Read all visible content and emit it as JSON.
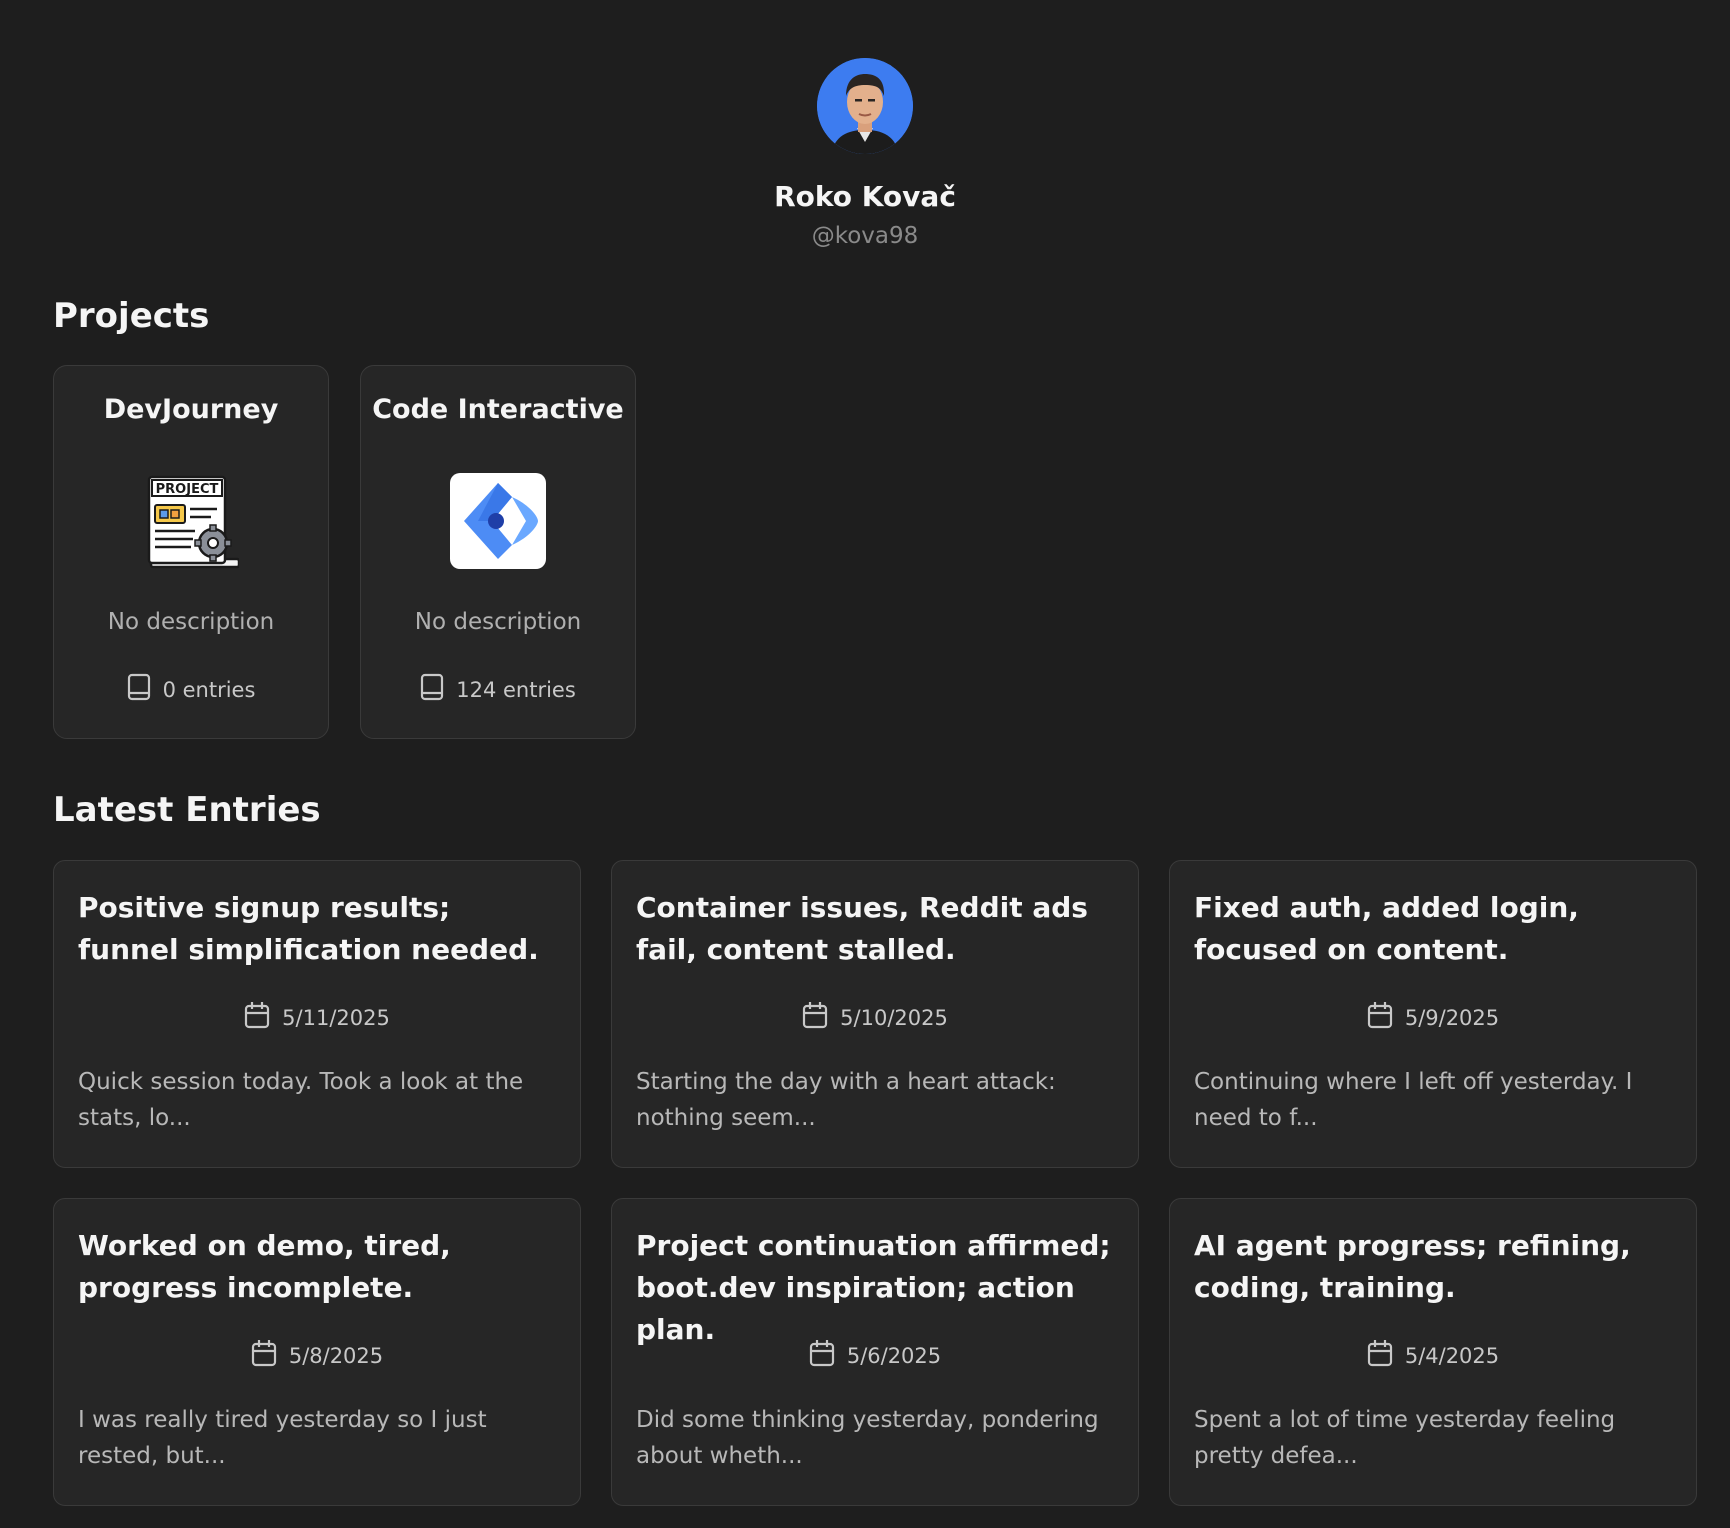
{
  "profile": {
    "name": "Roko Kovač",
    "handle": "@kova98"
  },
  "projects_section": {
    "title": "Projects"
  },
  "projects": [
    {
      "title": "DevJourney",
      "description": "No description",
      "entries": "0 entries"
    },
    {
      "title": "Code Interactive",
      "description": "No description",
      "entries": "124 entries"
    }
  ],
  "entries_section": {
    "title": "Latest Entries"
  },
  "entries": [
    {
      "title": "Positive signup results; funnel simplification needed.",
      "date": "5/11/2025",
      "excerpt": "Quick session today. Took a look at the stats, lo..."
    },
    {
      "title": "Container issues, Reddit ads fail, content stalled.",
      "date": "5/10/2025",
      "excerpt": "Starting the day with a heart attack: nothing seem..."
    },
    {
      "title": "Fixed auth, added login, focused on content.",
      "date": "5/9/2025",
      "excerpt": "Continuing where I left off yesterday. I need to f..."
    },
    {
      "title": "Worked on demo, tired, progress incomplete.",
      "date": "5/8/2025",
      "excerpt": "I was really tired yesterday so I just rested, but..."
    },
    {
      "title": "Project continuation affirmed; boot.dev inspiration; action plan.",
      "date": "5/6/2025",
      "excerpt": "Did some thinking yesterday, pondering about wheth..."
    },
    {
      "title": "AI agent progress; refining, coding, training.",
      "date": "5/4/2025",
      "excerpt": "Spent a lot of time yesterday feeling pretty defea..."
    }
  ],
  "colors": {
    "background": "#1e1e1e",
    "card": "#262626",
    "card_border": "#3a3a3a",
    "avatar_bg": "#3d7cf0",
    "muted_text": "#8a8a8a"
  },
  "icons": {
    "devjourney_logo": "project-document-gear-icon",
    "code_interactive_logo": "code-interactive-logo-icon",
    "entries_count": "book-icon",
    "date": "calendar-icon"
  }
}
